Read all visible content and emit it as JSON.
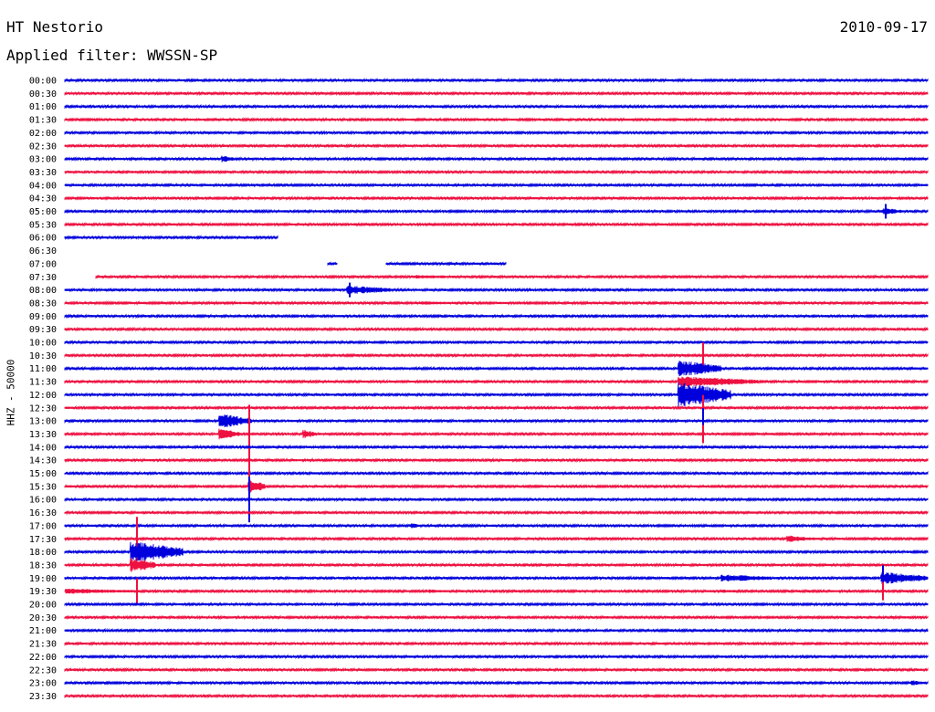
{
  "header": {
    "station": "HT Nestorio",
    "filter": "Applied filter: WWSSN-SP",
    "date": "2010-09-17",
    "channel": "HHZ - 50000"
  },
  "colors": {
    "even": "#0000dd",
    "odd": "#ee1040"
  },
  "chart_data": {
    "type": "line",
    "title": "HT Nestorio",
    "subtitle": "Applied filter: WWSSN-SP",
    "ylabel": "HHZ - 50000",
    "grid": false,
    "legend": "none",
    "x_range_minutes": [
      0,
      30
    ],
    "rows": [
      {
        "label": "00:00"
      },
      {
        "label": "00:30"
      },
      {
        "label": "01:00"
      },
      {
        "label": "01:30"
      },
      {
        "label": "02:00"
      },
      {
        "label": "02:30"
      },
      {
        "label": "03:00"
      },
      {
        "label": "03:30"
      },
      {
        "label": "04:00"
      },
      {
        "label": "04:30"
      },
      {
        "label": "05:00"
      },
      {
        "label": "05:30"
      },
      {
        "label": "06:00"
      },
      {
        "label": "06:30"
      },
      {
        "label": "07:00"
      },
      {
        "label": "07:30"
      },
      {
        "label": "08:00"
      },
      {
        "label": "08:30"
      },
      {
        "label": "09:00"
      },
      {
        "label": "09:30"
      },
      {
        "label": "10:00"
      },
      {
        "label": "10:30"
      },
      {
        "label": "11:00"
      },
      {
        "label": "11:30"
      },
      {
        "label": "12:00"
      },
      {
        "label": "12:30"
      },
      {
        "label": "13:00"
      },
      {
        "label": "13:30"
      },
      {
        "label": "14:00"
      },
      {
        "label": "14:30"
      },
      {
        "label": "15:00"
      },
      {
        "label": "15:30"
      },
      {
        "label": "16:00"
      },
      {
        "label": "16:30"
      },
      {
        "label": "17:00"
      },
      {
        "label": "17:30"
      },
      {
        "label": "18:00"
      },
      {
        "label": "18:30"
      },
      {
        "label": "19:00"
      },
      {
        "label": "19:30"
      },
      {
        "label": "20:00"
      },
      {
        "label": "20:30"
      },
      {
        "label": "21:00"
      },
      {
        "label": "21:30"
      },
      {
        "label": "22:00"
      },
      {
        "label": "22:30"
      },
      {
        "label": "23:00"
      },
      {
        "label": "23:30"
      }
    ]
  }
}
